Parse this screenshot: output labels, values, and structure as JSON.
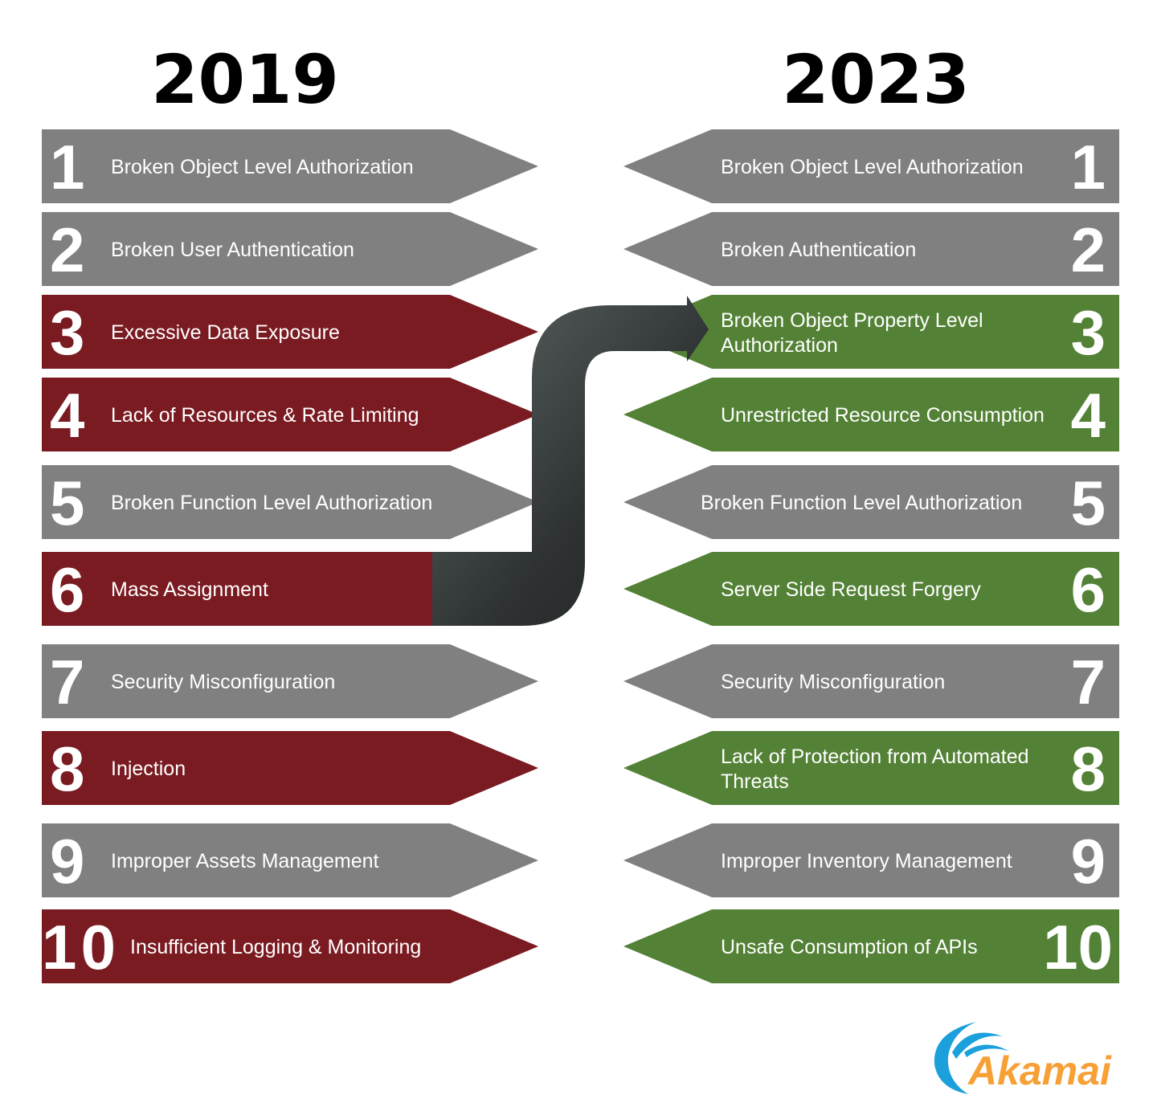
{
  "colors": {
    "unchanged": "#808080",
    "removed": "#7a1a21",
    "new": "#538135",
    "ribbon": "#3a3f3f",
    "logo_text": "#f7a035",
    "logo_wave": "#1ba0dc"
  },
  "left": {
    "year": "2019",
    "items": [
      {
        "rank": "1",
        "label": "Broken Object Level Authorization",
        "status": "unchanged"
      },
      {
        "rank": "2",
        "label": "Broken User Authentication",
        "status": "unchanged"
      },
      {
        "rank": "3",
        "label": "Excessive Data Exposure",
        "status": "removed"
      },
      {
        "rank": "4",
        "label": "Lack of Resources & Rate Limiting",
        "status": "removed"
      },
      {
        "rank": "5",
        "label": "Broken Function Level Authorization",
        "status": "unchanged"
      },
      {
        "rank": "6",
        "label": "Mass Assignment",
        "status": "removed"
      },
      {
        "rank": "7",
        "label": "Security Misconfiguration",
        "status": "unchanged"
      },
      {
        "rank": "8",
        "label": "Injection",
        "status": "removed"
      },
      {
        "rank": "9",
        "label": "Improper Assets Management",
        "status": "unchanged"
      },
      {
        "rank": "10",
        "label": "Insufficient Logging & Monitoring",
        "status": "removed"
      }
    ]
  },
  "right": {
    "year": "2023",
    "items": [
      {
        "rank": "1",
        "label": [
          "Broken Object Level Authorization"
        ],
        "status": "unchanged"
      },
      {
        "rank": "2",
        "label": [
          "Broken Authentication"
        ],
        "status": "unchanged"
      },
      {
        "rank": "3",
        "label": [
          "Broken Object Property Level",
          "Authorization"
        ],
        "status": "new"
      },
      {
        "rank": "4",
        "label": [
          "Unrestricted Resource Consumption"
        ],
        "status": "new"
      },
      {
        "rank": "5",
        "label": [
          "Broken Function Level Authorization"
        ],
        "status": "unchanged"
      },
      {
        "rank": "6",
        "label": [
          "Server Side Request Forgery"
        ],
        "status": "new"
      },
      {
        "rank": "7",
        "label": [
          "Security Misconfiguration"
        ],
        "status": "unchanged"
      },
      {
        "rank": "8",
        "label": [
          "Lack of Protection from Automated",
          "Threats"
        ],
        "status": "new"
      },
      {
        "rank": "9",
        "label": [
          "Improper Inventory Management"
        ],
        "status": "unchanged"
      },
      {
        "rank": "10",
        "label": [
          "Unsafe Consumption of APIs"
        ],
        "status": "new"
      }
    ]
  },
  "logo": {
    "text": "Akamai"
  }
}
